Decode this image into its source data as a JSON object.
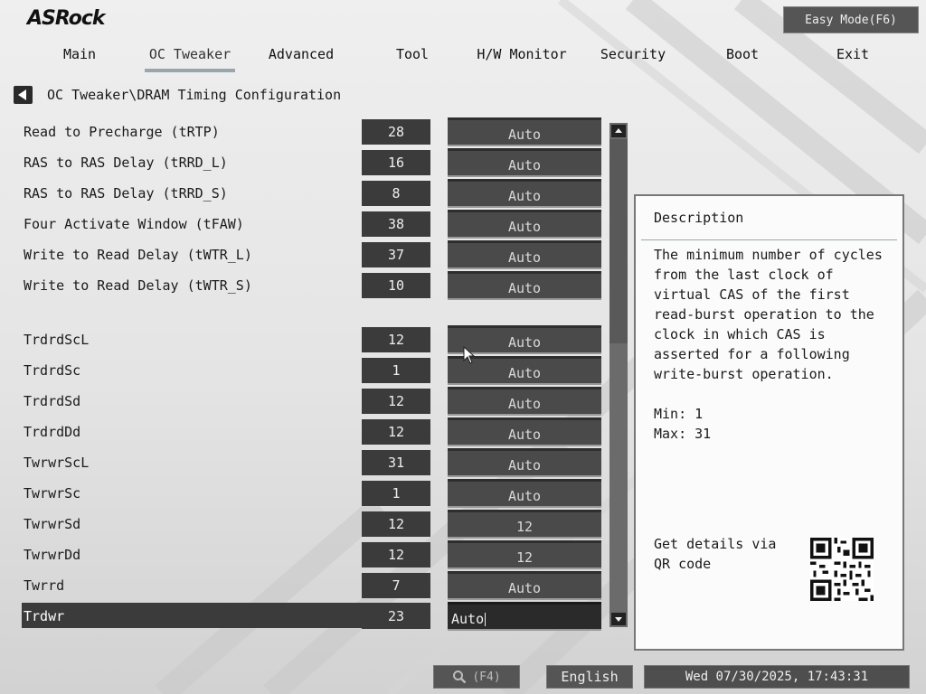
{
  "header": {
    "logo": "ASRock",
    "easy_mode_label": "Easy Mode(F6)"
  },
  "tabs": [
    {
      "label": "Main",
      "active": false
    },
    {
      "label": "OC Tweaker",
      "active": true
    },
    {
      "label": "Advanced",
      "active": false
    },
    {
      "label": "Tool",
      "active": false
    },
    {
      "label": "H/W Monitor",
      "active": false
    },
    {
      "label": "Security",
      "active": false
    },
    {
      "label": "Boot",
      "active": false
    },
    {
      "label": "Exit",
      "active": false
    }
  ],
  "breadcrumb": "OC Tweaker\\DRAM Timing Configuration",
  "rows": [
    {
      "label": "Read to Precharge (tRTP)",
      "value": "28",
      "setting": "Auto"
    },
    {
      "label": "RAS to RAS Delay (tRRD_L)",
      "value": "16",
      "setting": "Auto"
    },
    {
      "label": "RAS to RAS Delay (tRRD_S)",
      "value": "8",
      "setting": "Auto"
    },
    {
      "label": "Four Activate Window (tFAW)",
      "value": "38",
      "setting": "Auto"
    },
    {
      "label": "Write to Read Delay (tWTR_L)",
      "value": "37",
      "setting": "Auto"
    },
    {
      "label": "Write to Read Delay (tWTR_S)",
      "value": "10",
      "setting": "Auto"
    },
    {
      "label": "TrdrdScL",
      "value": "12",
      "setting": "Auto"
    },
    {
      "label": "TrdrdSc",
      "value": "1",
      "setting": "Auto"
    },
    {
      "label": "TrdrdSd",
      "value": "12",
      "setting": "Auto"
    },
    {
      "label": "TrdrdDd",
      "value": "12",
      "setting": "Auto"
    },
    {
      "label": "TwrwrScL",
      "value": "31",
      "setting": "Auto"
    },
    {
      "label": "TwrwrSc",
      "value": "1",
      "setting": "Auto"
    },
    {
      "label": "TwrwrSd",
      "value": "12",
      "setting": "12"
    },
    {
      "label": "TwrwrDd",
      "value": "12",
      "setting": "12"
    },
    {
      "label": "Twrrd",
      "value": "7",
      "setting": "Auto"
    },
    {
      "label": "Trdwr",
      "value": "23",
      "setting": "Auto",
      "selected": true
    }
  ],
  "description": {
    "title": "Description",
    "text": "The minimum number of cycles from the last clock of virtual CAS of the first read-burst operation to the clock in which CAS is asserted for a following write-burst operation.",
    "min": "Min: 1",
    "max": "Max: 31",
    "qr_text": "Get details via QR code"
  },
  "bottom": {
    "search_label": "(F4)",
    "language": "English",
    "datetime": "Wed 07/30/2025, 17:43:31"
  },
  "icons": {
    "back": "back-arrow-icon",
    "search": "search-icon",
    "scroll_up": "chevron-up-icon",
    "scroll_down": "chevron-down-icon",
    "qr": "qr-code-icon"
  },
  "colors": {
    "panel_dark": "#3b3b3b",
    "setting_bg": "#4a4a4a",
    "selected_setting_bg": "#2a2a2a",
    "scrollbar": "#6b6b6b"
  }
}
